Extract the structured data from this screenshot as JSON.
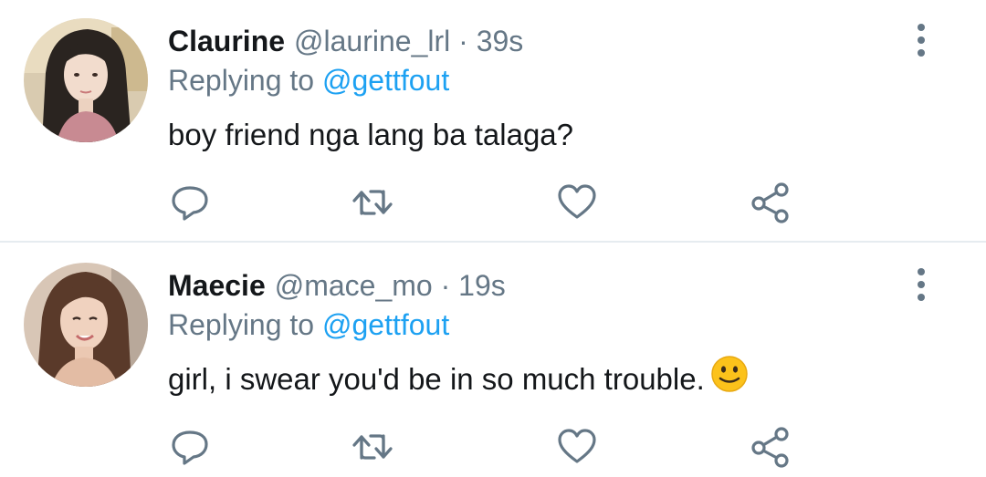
{
  "tweets": [
    {
      "name": "Claurine",
      "handle": "@laurine_lrl",
      "separator": "·",
      "time": "39s",
      "replying_prefix": "Replying to",
      "replying_to": "@gettfout",
      "text": "boy friend nga lang ba talaga?"
    },
    {
      "name": "Maecie",
      "handle": "@mace_mo",
      "separator": "·",
      "time": "19s",
      "replying_prefix": "Replying to",
      "replying_to": "@gettfout",
      "text": "girl, i swear you'd be in so much trouble.",
      "emoji": "slightly-smiling-face"
    }
  ],
  "icons": {
    "reply": "reply-icon",
    "retweet": "retweet-icon",
    "like": "heart-icon",
    "share": "share-icon",
    "more": "more-vertical-icon"
  },
  "colors": {
    "text": "#14171a",
    "secondary": "#657786",
    "link": "#1da1f2",
    "divider": "#e6ecf0"
  }
}
